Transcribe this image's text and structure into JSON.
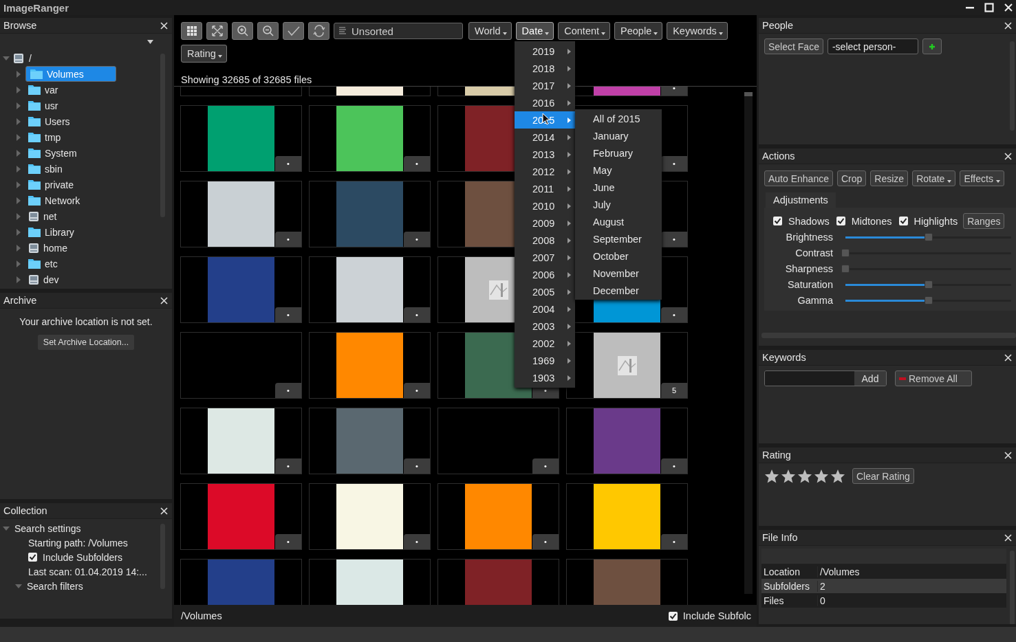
{
  "window": {
    "title": "ImageRanger"
  },
  "browse": {
    "title": "Browse",
    "root": {
      "label": "/",
      "expanded": true,
      "children": [
        {
          "label": "Volumes",
          "kind": "folder",
          "selected": true,
          "expanded": false
        },
        {
          "label": "var",
          "kind": "folder",
          "selected": false,
          "expanded": false
        },
        {
          "label": "usr",
          "kind": "folder",
          "selected": false,
          "expanded": false
        },
        {
          "label": "Users",
          "kind": "folder",
          "selected": false,
          "expanded": false
        },
        {
          "label": "tmp",
          "kind": "folder",
          "selected": false,
          "expanded": false
        },
        {
          "label": "System",
          "kind": "folder",
          "selected": false,
          "expanded": false
        },
        {
          "label": "sbin",
          "kind": "folder",
          "selected": false,
          "expanded": false
        },
        {
          "label": "private",
          "kind": "folder",
          "selected": false,
          "expanded": false
        },
        {
          "label": "Network",
          "kind": "folder",
          "selected": false,
          "expanded": false
        },
        {
          "label": "net",
          "kind": "drive",
          "selected": false,
          "expanded": false
        },
        {
          "label": "Library",
          "kind": "folder",
          "selected": false,
          "expanded": false
        },
        {
          "label": "home",
          "kind": "drive",
          "selected": false,
          "expanded": false
        },
        {
          "label": "etc",
          "kind": "folder",
          "selected": false,
          "expanded": false
        },
        {
          "label": "dev",
          "kind": "drive",
          "selected": false,
          "expanded": false
        }
      ]
    }
  },
  "archive": {
    "title": "Archive",
    "message": "Your archive location is not set.",
    "button": "Set Archive Location..."
  },
  "collection": {
    "title": "Collection",
    "tree": [
      {
        "label": "Search settings",
        "expanded": true,
        "children": [
          {
            "kind": "text",
            "label": "Starting path: /Volumes"
          },
          {
            "kind": "checkbox",
            "label": "Include Subfolders",
            "checked": true
          },
          {
            "kind": "text",
            "label": "Last scan: 01.04.2019 14:..."
          }
        ]
      },
      {
        "label": "Search filters",
        "expanded": true
      }
    ]
  },
  "toolbar": {
    "filter": "Unsorted",
    "dropdowns": [
      {
        "label": "World",
        "open": false
      },
      {
        "label": "Date",
        "open": true
      },
      {
        "label": "Content",
        "open": false
      },
      {
        "label": "People",
        "open": false
      },
      {
        "label": "Keywords",
        "open": false
      },
      {
        "label": "Rating",
        "open": false
      }
    ]
  },
  "summary": "Showing 32685 of 32685 files",
  "thumbnails": [
    {
      "kind": "empty"
    },
    {
      "kind": "color",
      "color": "#f5ecdc"
    },
    {
      "kind": "color",
      "color": "#d8cba8"
    },
    {
      "kind": "color",
      "color": "#c040a8",
      "badge": "•"
    },
    {
      "kind": "color",
      "color": "#00a070",
      "badge": "•"
    },
    {
      "kind": "color",
      "color": "#4cc45a",
      "badge": "•"
    },
    {
      "kind": "color",
      "color": "#7f2226"
    },
    {
      "kind": "empty",
      "badge": "•"
    },
    {
      "kind": "color",
      "color": "#c9d0d4",
      "badge": "•"
    },
    {
      "kind": "color",
      "color": "#2c4a62",
      "badge": "•"
    },
    {
      "kind": "color",
      "color": "#6e5040"
    },
    {
      "kind": "empty",
      "badge": "•"
    },
    {
      "kind": "color",
      "color": "#233f8a",
      "badge": "•"
    },
    {
      "kind": "color",
      "color": "#ccd2d6",
      "badge": "•"
    },
    {
      "kind": "placeholder"
    },
    {
      "kind": "color",
      "color": "#0096d6",
      "badge": "•"
    },
    {
      "kind": "empty",
      "badge": "•"
    },
    {
      "kind": "color",
      "color": "#ff8800",
      "badge": "•"
    },
    {
      "kind": "color",
      "color": "#3b6a50",
      "badge": "•"
    },
    {
      "kind": "placeholder",
      "badge": "5"
    },
    {
      "kind": "color",
      "color": "#dde8e4",
      "badge": "•"
    },
    {
      "kind": "color",
      "color": "#5a6870",
      "badge": "•"
    },
    {
      "kind": "empty",
      "badge": "•"
    },
    {
      "kind": "color",
      "color": "#6a3a8a",
      "badge": "•"
    },
    {
      "kind": "color",
      "color": "#dc0a28",
      "badge": "•"
    },
    {
      "kind": "color",
      "color": "#f8f6e4",
      "badge": "•"
    },
    {
      "kind": "color",
      "color": "#ff8800",
      "badge": "•"
    },
    {
      "kind": "color",
      "color": "#ffc800",
      "badge": "•"
    },
    {
      "kind": "color",
      "color": "#233f8a"
    },
    {
      "kind": "color",
      "color": "#dbe8e6"
    },
    {
      "kind": "color",
      "color": "#7f2226"
    },
    {
      "kind": "color",
      "color": "#6e5040"
    }
  ],
  "date_menu": {
    "years": [
      {
        "label": "2019",
        "selected": false
      },
      {
        "label": "2018",
        "selected": false
      },
      {
        "label": "2017",
        "selected": false
      },
      {
        "label": "2016",
        "selected": false
      },
      {
        "label": "2015",
        "selected": true
      },
      {
        "label": "2014",
        "selected": false
      },
      {
        "label": "2013",
        "selected": false
      },
      {
        "label": "2012",
        "selected": false
      },
      {
        "label": "2011",
        "selected": false
      },
      {
        "label": "2010",
        "selected": false
      },
      {
        "label": "2009",
        "selected": false
      },
      {
        "label": "2008",
        "selected": false
      },
      {
        "label": "2007",
        "selected": false
      },
      {
        "label": "2006",
        "selected": false
      },
      {
        "label": "2005",
        "selected": false
      },
      {
        "label": "2004",
        "selected": false
      },
      {
        "label": "2003",
        "selected": false
      },
      {
        "label": "2002",
        "selected": false
      },
      {
        "label": "1969",
        "selected": false
      },
      {
        "label": "1903",
        "selected": false
      }
    ],
    "submenu": [
      "All of 2015",
      "January",
      "February",
      "May",
      "June",
      "July",
      "August",
      "September",
      "October",
      "November",
      "December"
    ]
  },
  "status_bar": {
    "path": "/Volumes",
    "include_subfolders": {
      "label": "Include Subfolc",
      "checked": true
    }
  },
  "people": {
    "title": "People",
    "select_face": "Select Face",
    "person": "-select person-"
  },
  "actions": {
    "title": "Actions",
    "buttons": [
      {
        "label": "Auto Enhance",
        "dropdown": false
      },
      {
        "label": "Crop",
        "dropdown": false
      },
      {
        "label": "Resize",
        "dropdown": false
      },
      {
        "label": "Rotate",
        "dropdown": true
      },
      {
        "label": "Effects",
        "dropdown": true
      }
    ],
    "tab": "Adjustments",
    "checks": [
      {
        "label": "Shadows",
        "checked": true
      },
      {
        "label": "Midtones",
        "checked": true
      },
      {
        "label": "Highlights",
        "checked": true
      }
    ],
    "ranges": "Ranges",
    "sliders": [
      {
        "label": "Brightness",
        "level": 0.5
      },
      {
        "label": "Contrast",
        "level": 0
      },
      {
        "label": "Sharpness",
        "level": 0
      },
      {
        "label": "Saturation",
        "level": 0.5
      },
      {
        "label": "Gamma",
        "level": 0.5
      }
    ]
  },
  "keywords": {
    "title": "Keywords",
    "add": "Add",
    "remove_all": "Remove All"
  },
  "rating": {
    "title": "Rating",
    "clear": "Clear Rating"
  },
  "file_info": {
    "title": "File Info",
    "rows": [
      {
        "key": "Location",
        "value": "/Volumes",
        "selected": false
      },
      {
        "key": "Subfolders",
        "value": "2",
        "selected": true
      },
      {
        "key": "Files",
        "value": "0",
        "selected": false
      }
    ]
  }
}
